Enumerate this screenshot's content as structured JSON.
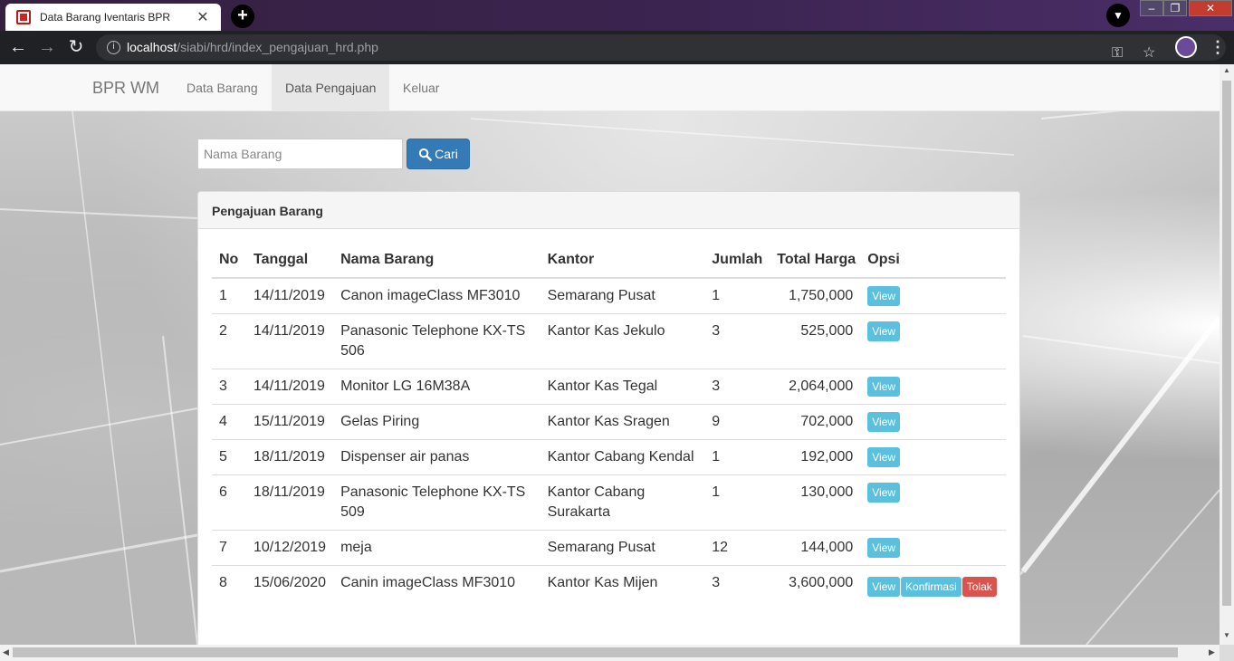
{
  "browser": {
    "active_tab_title": "Data Barang Iventaris BPR",
    "inactive_tab_1": "",
    "inactive_tab_2": "",
    "url_host": "localhost",
    "url_path": "/siabi/hrd/index_pengajuan_hrd.php"
  },
  "navbar": {
    "brand": "BPR WM",
    "links": [
      {
        "label": "Data Barang"
      },
      {
        "label": "Data Pengajuan"
      },
      {
        "label": "Keluar"
      }
    ]
  },
  "search": {
    "placeholder": "Nama Barang",
    "value": "",
    "button_label": "Cari"
  },
  "panel": {
    "title": "Pengajuan Barang",
    "columns": [
      "No",
      "Tanggal",
      "Nama Barang",
      "Kantor",
      "Jumlah",
      "Total Harga",
      "Opsi"
    ],
    "rows": [
      {
        "no": "1",
        "tanggal": "14/11/2019",
        "nama": "Canon imageClass MF3010",
        "kantor": "Semarang Pusat",
        "jumlah": "1",
        "total": "1,750,000",
        "actions": [
          "View"
        ]
      },
      {
        "no": "2",
        "tanggal": "14/11/2019",
        "nama": "Panasonic Telephone KX-TS 506",
        "kantor": "Kantor Kas Jekulo",
        "jumlah": "3",
        "total": "525,000",
        "actions": [
          "View"
        ]
      },
      {
        "no": "3",
        "tanggal": "14/11/2019",
        "nama": "Monitor LG 16M38A",
        "kantor": "Kantor Kas Tegal",
        "jumlah": "3",
        "total": "2,064,000",
        "actions": [
          "View"
        ]
      },
      {
        "no": "4",
        "tanggal": "15/11/2019",
        "nama": "Gelas Piring",
        "kantor": "Kantor Kas Sragen",
        "jumlah": "9",
        "total": "702,000",
        "actions": [
          "View"
        ]
      },
      {
        "no": "5",
        "tanggal": "18/11/2019",
        "nama": "Dispenser air panas",
        "kantor": "Kantor Cabang Kendal",
        "jumlah": "1",
        "total": "192,000",
        "actions": [
          "View"
        ]
      },
      {
        "no": "6",
        "tanggal": "18/11/2019",
        "nama": "Panasonic Telephone KX-TS 509",
        "kantor": "Kantor Cabang Surakarta",
        "jumlah": "1",
        "total": "130,000",
        "actions": [
          "View"
        ]
      },
      {
        "no": "7",
        "tanggal": "10/12/2019",
        "nama": "meja",
        "kantor": "Semarang Pusat",
        "jumlah": "12",
        "total": "144,000",
        "actions": [
          "View"
        ]
      },
      {
        "no": "8",
        "tanggal": "15/06/2020",
        "nama": "Canin imageClass MF3010",
        "kantor": "Kantor Kas Mijen",
        "jumlah": "3",
        "total": "3,600,000",
        "actions": [
          "View",
          "Konfirmasi",
          "Tolak"
        ]
      }
    ]
  },
  "colors": {
    "primary": "#337ab7",
    "info": "#5bc0de",
    "danger": "#d9534f"
  }
}
